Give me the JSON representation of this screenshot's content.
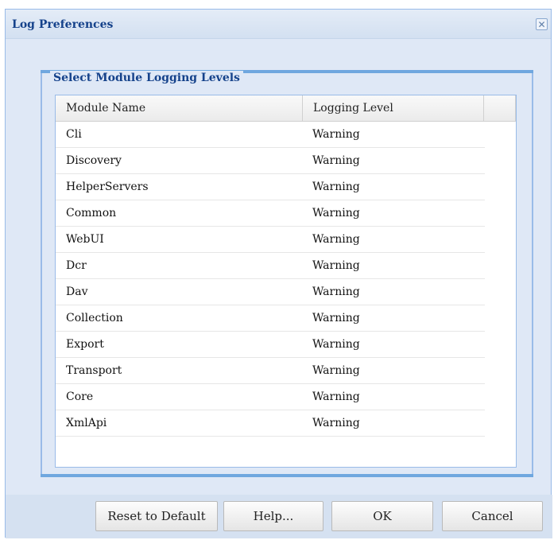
{
  "dialog": {
    "title": "Log Preferences",
    "close_symbol": "✕"
  },
  "fieldset": {
    "legend": "Select Module Logging Levels"
  },
  "grid": {
    "columns": [
      "Module Name",
      "Logging Level"
    ],
    "rows": [
      {
        "module": "Cli",
        "level": "Warning"
      },
      {
        "module": "Discovery",
        "level": "Warning"
      },
      {
        "module": "HelperServers",
        "level": "Warning"
      },
      {
        "module": "Common",
        "level": "Warning"
      },
      {
        "module": "WebUI",
        "level": "Warning"
      },
      {
        "module": "Dcr",
        "level": "Warning"
      },
      {
        "module": "Dav",
        "level": "Warning"
      },
      {
        "module": "Collection",
        "level": "Warning"
      },
      {
        "module": "Export",
        "level": "Warning"
      },
      {
        "module": "Transport",
        "level": "Warning"
      },
      {
        "module": "Core",
        "level": "Warning"
      },
      {
        "module": "XmlApi",
        "level": "Warning"
      }
    ]
  },
  "buttons": {
    "reset": "Reset to Default",
    "help": "Help...",
    "ok": "OK",
    "cancel": "Cancel"
  },
  "colors": {
    "accent": "#15428b",
    "panel_background": "#dfe8f6",
    "border": "#99bbe8"
  }
}
